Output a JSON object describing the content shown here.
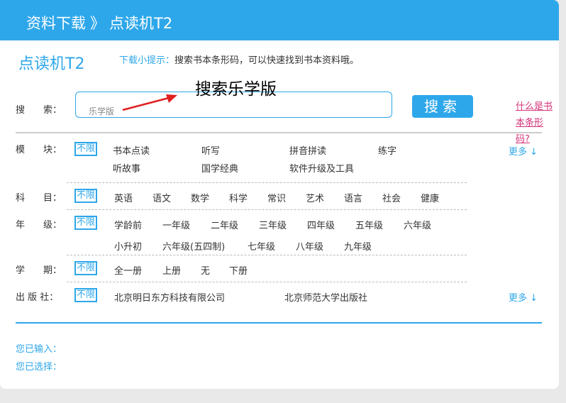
{
  "header": {
    "section": "资料下载",
    "separator": "》",
    "page": "点读机T2"
  },
  "title": "点读机T2",
  "tip": {
    "label": "下载小提示：",
    "text": "搜索书本条形码，可以快速找到书本资料哦。"
  },
  "search": {
    "label": "搜　　索：",
    "value": "乐学版",
    "button": "搜索",
    "what_link": "什么是书本条形码?",
    "annotation": "搜索乐学版"
  },
  "unlimited_label": "不限",
  "more_label": "更多 ↓",
  "filters": {
    "module": {
      "label": "模　　块：",
      "options": [
        "书本点读",
        "听写",
        "拼音拼读",
        "练字",
        "听故事",
        "国学经典",
        "软件升级及工具"
      ]
    },
    "subject": {
      "label": "科　　目：",
      "options": [
        "英语",
        "语文",
        "数学",
        "科学",
        "常识",
        "艺术",
        "语言",
        "社会",
        "健康"
      ]
    },
    "grade": {
      "label": "年　　级：",
      "options": [
        "学龄前",
        "一年级",
        "二年级",
        "三年级",
        "四年级",
        "五年级",
        "六年级",
        "小升初",
        "六年级(五四制)",
        "七年级",
        "八年级",
        "九年级"
      ]
    },
    "term": {
      "label": "学　　期：",
      "options": [
        "全一册",
        "上册",
        "无",
        "下册"
      ]
    },
    "publisher": {
      "label": "出 版 社：",
      "options": [
        "北京明日东方科技有限公司",
        "北京师范大学出版社"
      ]
    }
  },
  "footer": {
    "entered": "您已输入：",
    "selected": "您已选择："
  },
  "colors": {
    "accent": "#2ea7ea",
    "link": "#d6337a"
  }
}
